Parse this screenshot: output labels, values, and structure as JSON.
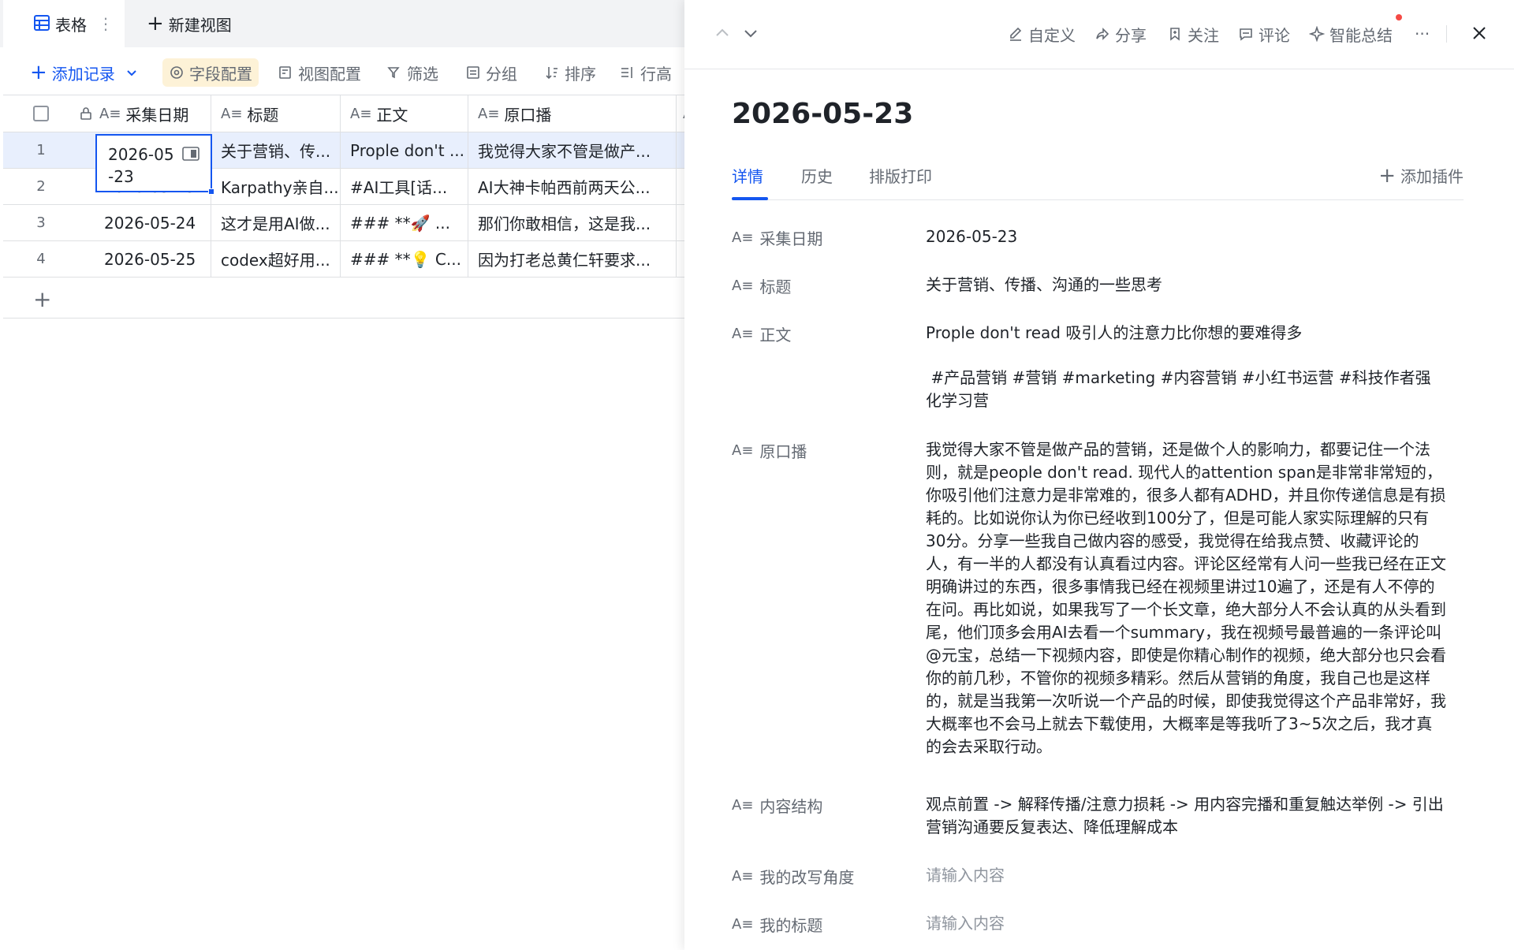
{
  "view_tabs": {
    "active_label": "表格",
    "more": "⋮",
    "new_view_label": "新建视图"
  },
  "toolbar": {
    "add_record": "添加记录",
    "field_config": "字段配置",
    "view_config": "视图配置",
    "filter": "筛选",
    "group": "分组",
    "sort": "排序",
    "row_height": "行高"
  },
  "table": {
    "columns": [
      "采集日期",
      "标题",
      "正文",
      "原口播"
    ],
    "rows": [
      {
        "index": "1",
        "date": "2026-05-23",
        "title": "关于营销、传...",
        "body": "Prople don't ...",
        "script": "我觉得大家不管是做产..."
      },
      {
        "index": "2",
        "date": "2026-05-23",
        "title": "Karpathy亲自...",
        "body": "#AI工具[话...",
        "script": "AI大神卡帕西前两天公..."
      },
      {
        "index": "3",
        "date": "2026-05-24",
        "title": "这才是用AI做...",
        "body": "### **🚀 ...",
        "script": "那们你敢相信，这是我..."
      },
      {
        "index": "4",
        "date": "2026-05-25",
        "title": "codex超好用...",
        "body": "### **💡 C...",
        "script": "因为打老总黄仁轩要求..."
      }
    ],
    "active_cell": {
      "line1": "2026-05",
      "line2": "-23"
    }
  },
  "panel": {
    "actions": {
      "customize": "自定义",
      "share": "分享",
      "follow": "关注",
      "comment": "评论",
      "ai_summary": "智能总结",
      "more": "···"
    },
    "record_title": "2026-05-23",
    "tabs": {
      "details": "详情",
      "history": "历史",
      "print": "排版打印"
    },
    "add_plugin": "添加插件",
    "fields": [
      {
        "label": "采集日期",
        "value": "2026-05-23"
      },
      {
        "label": "标题",
        "value": "关于营销、传播、沟通的一些思考"
      },
      {
        "label": "正文",
        "value": "Prople don't read 吸引人的注意力比你想的要难得多",
        "value2": " #产品营销 #营销 #marketing #内容营销 #小红书运营 #科技作者强化学习营"
      },
      {
        "label": "原口播",
        "value": "我觉得大家不管是做产品的营销，还是做个人的影响力，都要记住一个法则，就是people don't read. 现代人的attention span是非常非常短的，你吸引他们注意力是非常难的，很多人都有ADHD，并且你传递信息是有损耗的。比如说你认为你已经收到100分了，但是可能人家实际理解的只有30分。分享一些我自己做内容的感受，我觉得在给我点赞、收藏评论的人，有一半的人都没有认真看过内容。评论区经常有人问一些我已经在正文明确讲过的东西，很多事情我已经在视频里讲过10遍了，还是有人不停的在问。再比如说，如果我写了一个长文章，绝大部分人不会认真的从头看到尾，他们顶多会用AI去看一个summary，我在视频号最普遍的一条评论叫@元宝，总结一下视频内容，即使是你精心制作的视频，绝大部分也只会看你的前几秒，不管你的视频多精彩。然后从营销的角度，我自己也是这样的，就是当我第一次听说一个产品的时候，即使我觉得这个产品非常好，我大概率也不会马上就去下载使用，大概率是等我听了3~5次之后，我才真的会去采取行动。"
      },
      {
        "label": "内容结构",
        "value": "观点前置 -> 解释传播/注意力损耗 -> 用内容完播和重复触达举例 -> 引出营销沟通要反复表达、降低理解成本"
      },
      {
        "label": "我的改写角度",
        "placeholder": "请输入内容"
      },
      {
        "label": "我的标题",
        "placeholder": "请输入内容"
      }
    ]
  }
}
